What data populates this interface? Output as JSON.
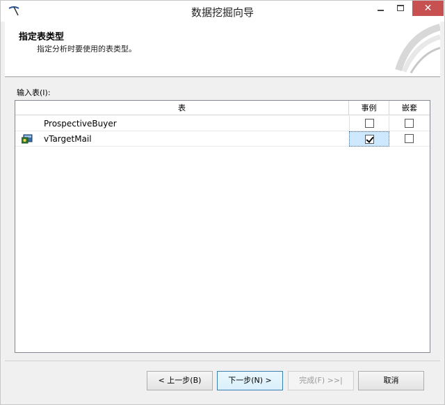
{
  "window": {
    "title": "数据挖掘向导",
    "minimize": "—",
    "maximize": "□",
    "close": "✕"
  },
  "banner": {
    "title": "指定表类型",
    "subtitle": "指定分析时要使用的表类型。"
  },
  "input_tables": {
    "label": "输入表(I):",
    "columns": [
      "表",
      "事例",
      "嵌套"
    ],
    "rows": [
      {
        "name": "ProspectiveBuyer",
        "case": false,
        "nested": false,
        "has_icon": false
      },
      {
        "name": "vTargetMail",
        "case": true,
        "nested": false,
        "has_icon": true,
        "icon": "table-icon"
      }
    ]
  },
  "buttons": {
    "back": "< 上一步(B)",
    "next": "下一步(N) >",
    "finish": "完成(F) >>|",
    "cancel": "取消"
  },
  "colors": {
    "close_button": "#c75050",
    "selection": "#cde8ff",
    "default_button_border": "#3c7fb1"
  }
}
